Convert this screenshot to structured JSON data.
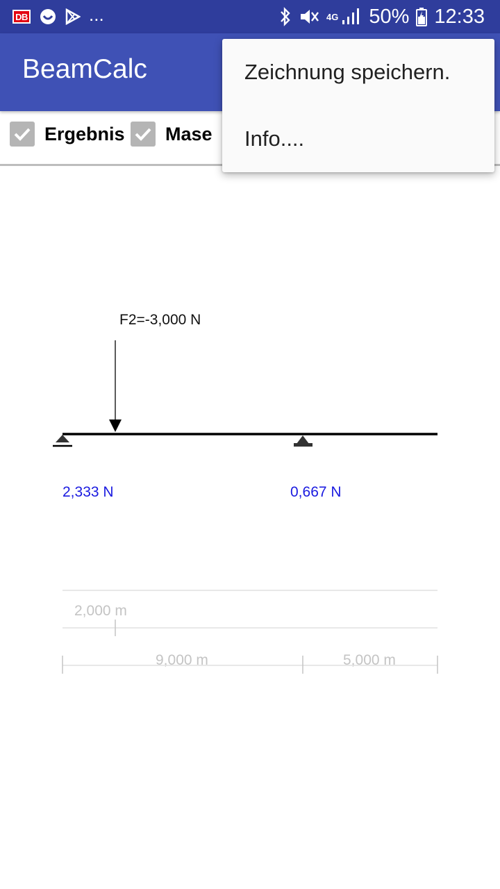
{
  "status_bar": {
    "db_badge": "DB",
    "more": "...",
    "network": "4G",
    "battery": "50%",
    "time": "12:33"
  },
  "app_bar": {
    "title": "BeamCalc"
  },
  "options": {
    "result_label": "Ergebnis",
    "dimensions_label": "Mase"
  },
  "drawing": {
    "force_label": "F2=-3,000 N",
    "reaction_left": "2,333 N",
    "reaction_right": "0,667 N",
    "dim_force_position": "2,000 m",
    "dim_span_left": "9,000 m",
    "dim_span_right": "5,000 m",
    "colors": {
      "beam": "#000000",
      "reaction": "#1a1ae0",
      "dimension": "#c4c4c4"
    }
  },
  "menu": {
    "items": [
      "Zeichnung speichern.",
      "Info...."
    ]
  },
  "theme": {
    "status_bar": "#2f3d9c",
    "app_bar": "#3f51b5",
    "checkbox": "#b5b5b5"
  }
}
